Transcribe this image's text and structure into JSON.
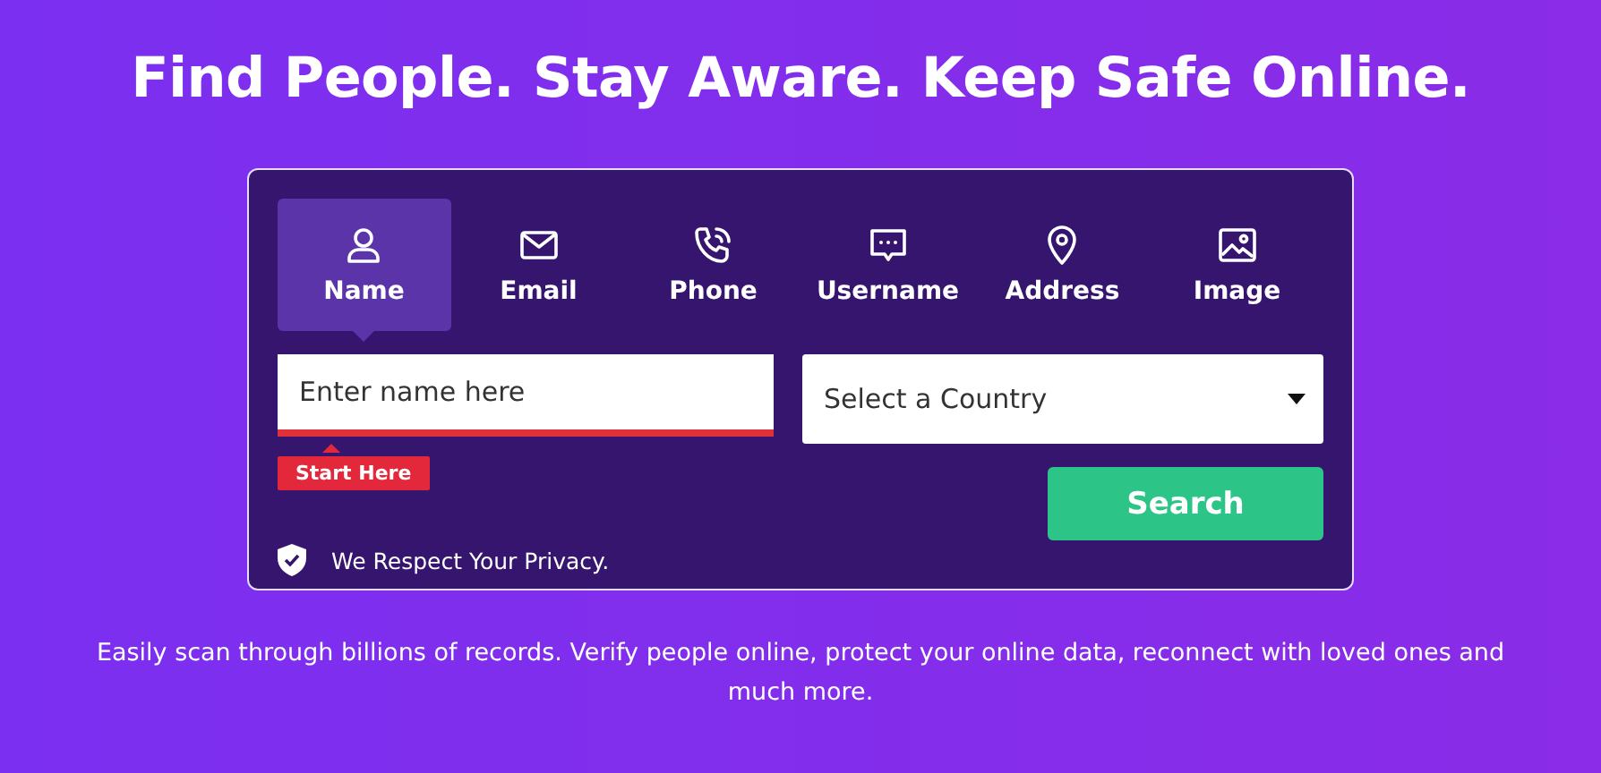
{
  "headline": "Find People. Stay Aware. Keep Safe Online.",
  "tabs": [
    {
      "label": "Name",
      "kind": "person",
      "selected": true
    },
    {
      "label": "Email",
      "kind": "envelope",
      "selected": false
    },
    {
      "label": "Phone",
      "kind": "phone",
      "selected": false
    },
    {
      "label": "Username",
      "kind": "chat",
      "selected": false
    },
    {
      "label": "Address",
      "kind": "pin",
      "selected": false
    },
    {
      "label": "Image",
      "kind": "image",
      "selected": false
    }
  ],
  "name_field": {
    "placeholder": "Enter name here"
  },
  "hint": "Start Here",
  "country_select": {
    "value": "Select a Country"
  },
  "search_button": "Search",
  "privacy": "We Respect Your Privacy.",
  "description": "Easily scan through billions of records. Verify people online, protect your online data, reconnect with loved ones and much more."
}
